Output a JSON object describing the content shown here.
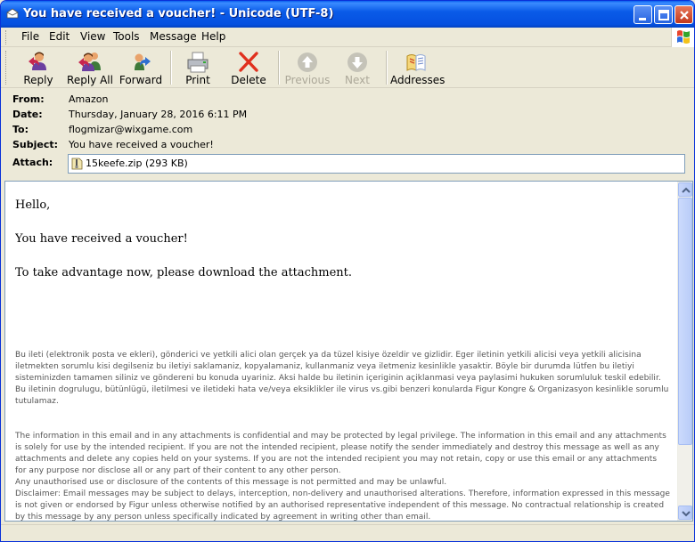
{
  "window": {
    "title": "You have received a voucher! - Unicode (UTF-8)"
  },
  "menu": {
    "items": [
      "File",
      "Edit",
      "View",
      "Tools",
      "Message",
      "Help"
    ]
  },
  "toolbar": {
    "reply": "Reply",
    "reply_all": "Reply All",
    "forward": "Forward",
    "print": "Print",
    "delete": "Delete",
    "previous": "Previous",
    "next": "Next",
    "addresses": "Addresses"
  },
  "header": {
    "from_label": "From:",
    "from": "Amazon",
    "date_label": "Date:",
    "date": "Thursday, January 28, 2016 6:11 PM",
    "to_label": "To:",
    "to": "flogmizar@wixgame.com",
    "subject_label": "Subject:",
    "subject": "You have received a voucher!",
    "attach_label": "Attach:",
    "attachment": "15keefe.zip (293 KB)"
  },
  "message": {
    "line1": "Hello,",
    "line2": "You have received a voucher!",
    "line3": "To take advantage now, please download the attachment.",
    "disclaimer_tr_1": "Bu ileti (elektronik posta ve ekleri), gönderici ve yetkili alici olan gerçek ya da tüzel kisiye özeldir ve gizlidir. Eger iletinin yetkili alicisi veya yetkili alicisina iletmekten sorumlu kisi degilseniz bu iletiyi saklamaniz, kopyalamaniz, kullanmaniz veya iletmeniz kesinlikle yasaktir. Böyle bir durumda lütfen bu iletiyi sisteminizden tamamen siliniz ve göndereni bu konuda uyariniz. Aksi halde bu iletinin içeriginin açiklanmasi veya paylasimi hukuken sorumluluk teskil edebilir.",
    "disclaimer_tr_2": "Bu iletinin dogrulugu, bütünlügü, iletilmesi ve iletideki hata ve/veya eksiklikler ile virus vs.gibi benzeri konularda Figur Kongre & Organizasyon kesinlikle sorumlu tutulamaz.",
    "disclaimer_en_1": "The information in this email and in any attachments is confidential and may be protected by legal privilege. The information in this email and any attachments is solely for use by the intended recipient. If you are not the intended recipient, please notify the sender immediately and destroy this message as well as any attachments and delete any copies held on your systems. If you are not the intended recipient you may not retain, copy or use this email or any attachments for any purpose nor disclose all or any part of their content to any other person.",
    "disclaimer_en_2": "Any unauthorised use or disclosure of the contents of this message is not permitted and may be unlawful.",
    "disclaimer_en_3": "Disclaimer: Email messages may be subject to delays, interception, non-delivery and unauthorised alterations. Therefore, information expressed in this message is not given or endorsed by Figur unless otherwise notified by an authorised representative independent of this message. No contractual relationship is created by this message by any person unless specifically indicated by agreement in writing other than email."
  },
  "colors": {
    "titlebar": "#0A5BE8",
    "chrome": "#ECE9D8",
    "border": "#7F9DB9",
    "delete_red": "#E0301E"
  }
}
